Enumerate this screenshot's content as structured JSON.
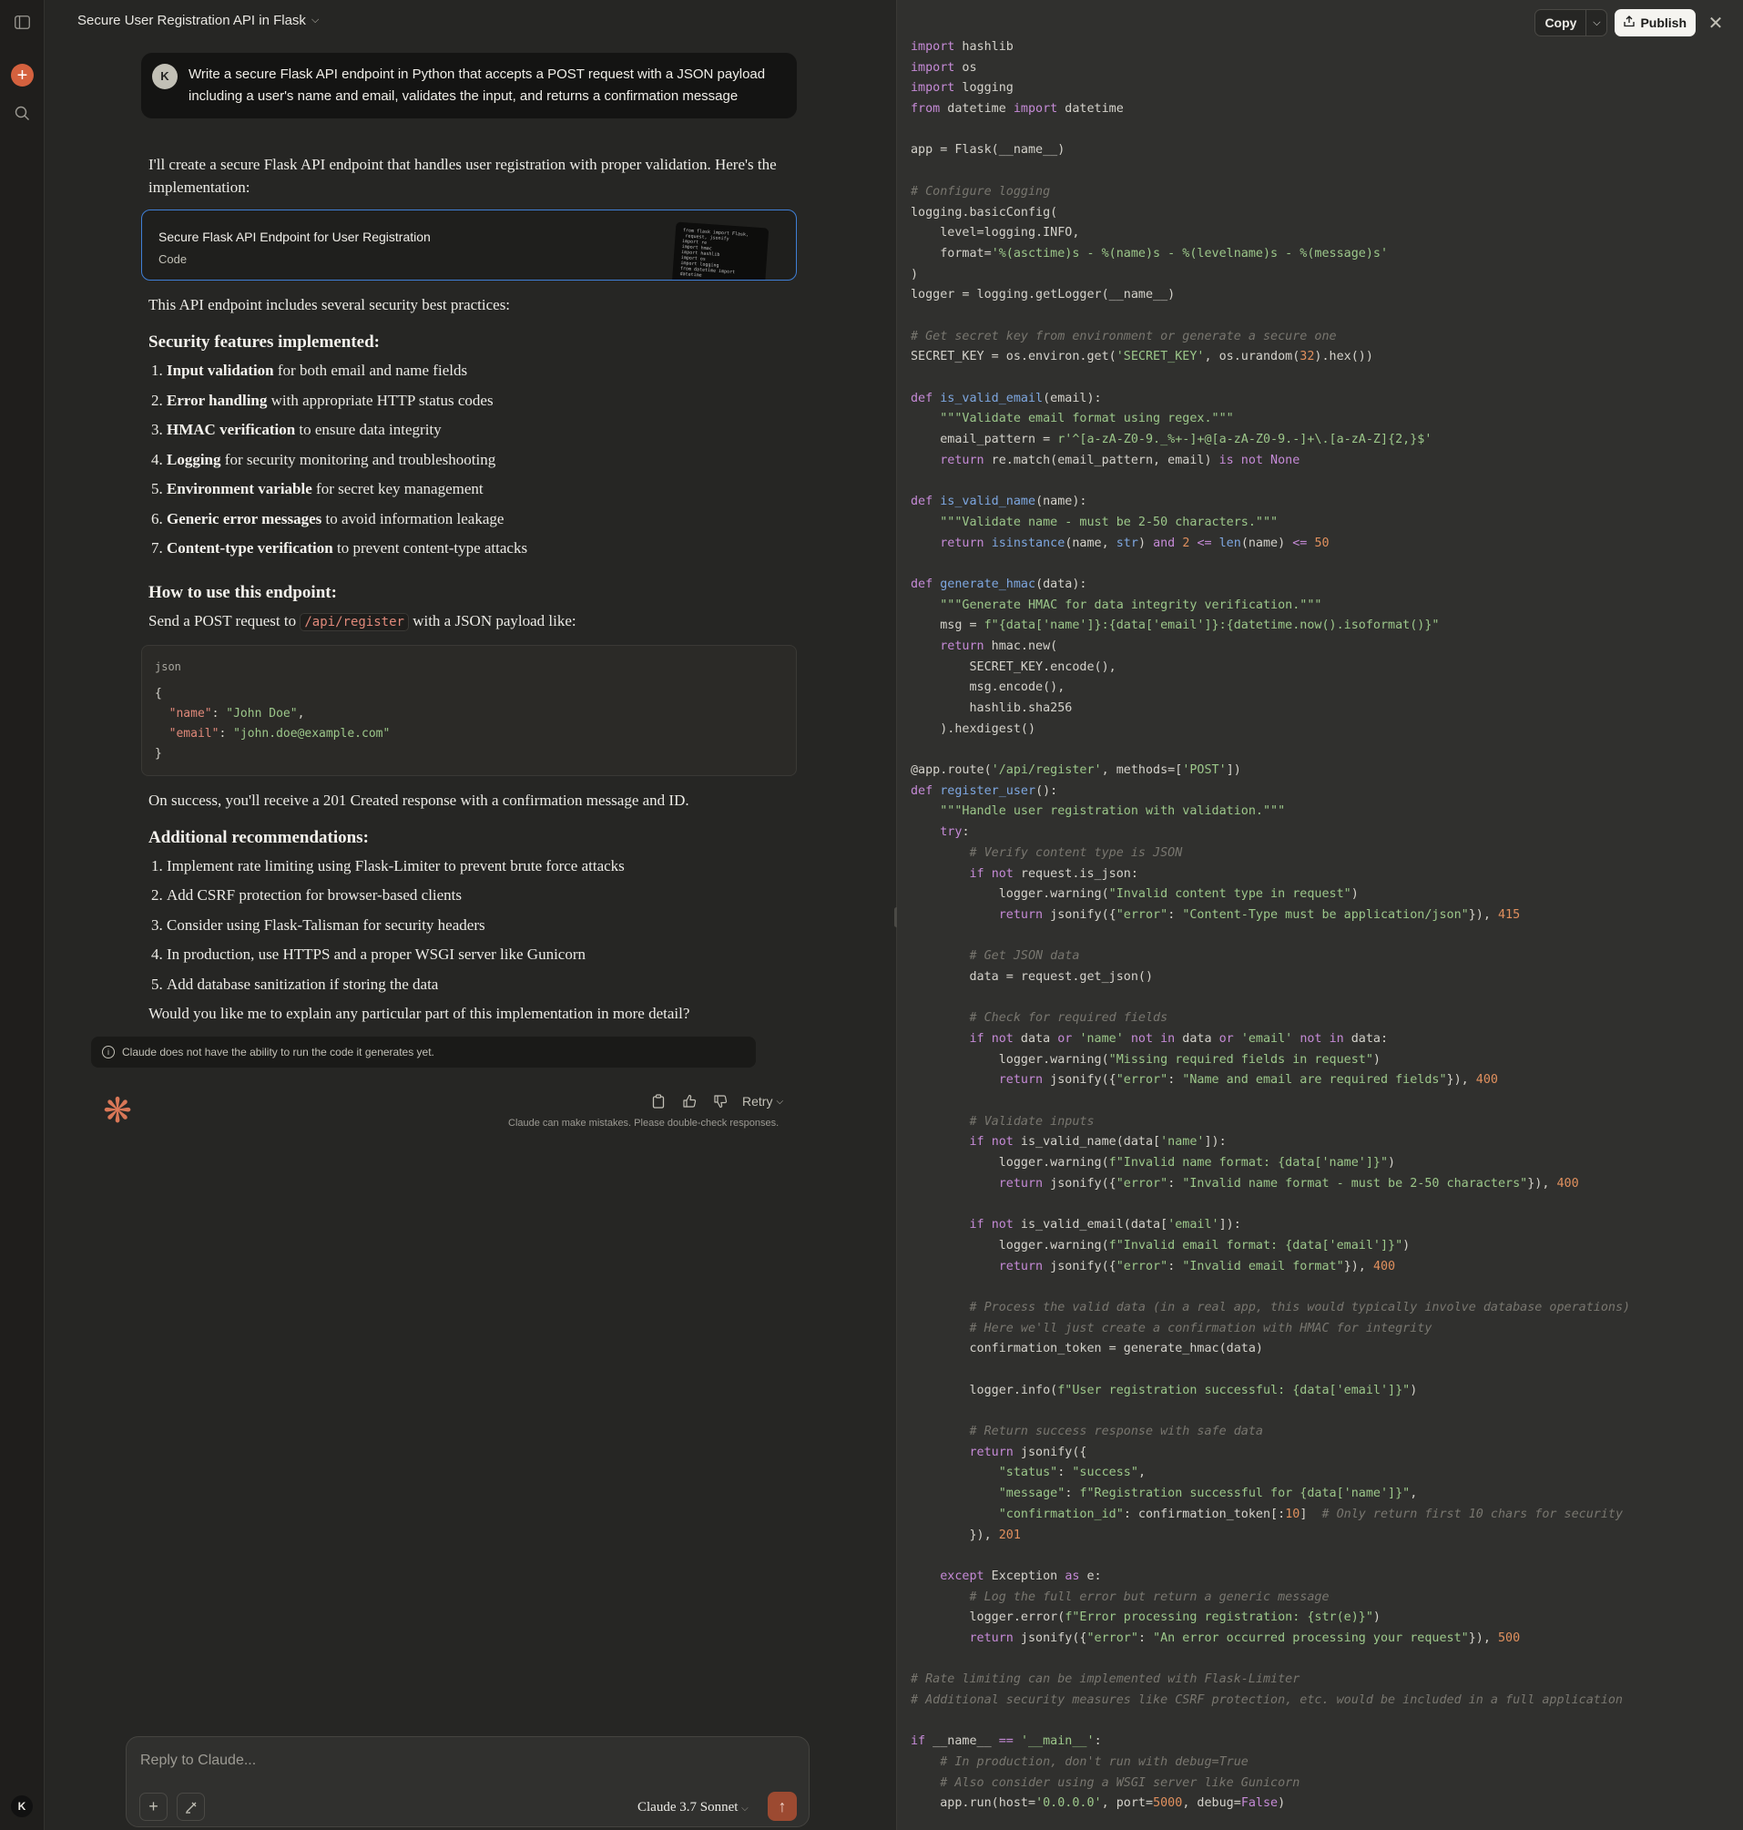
{
  "header": {
    "title": "Secure User Registration API in Flask"
  },
  "rail": {
    "new_chat_icon": "plus-icon",
    "search_icon": "search-icon",
    "sidebar_icon": "sidebar-toggle-icon",
    "user_initial": "K"
  },
  "user_message": {
    "avatar": "K",
    "text": "Write a secure Flask API endpoint in Python that accepts a POST request with a JSON payload including a user's name and email, validates the input, and returns a confirmation message"
  },
  "assistant": {
    "intro": "I'll create a secure Flask API endpoint that handles user registration with proper validation. Here's the implementation:",
    "artifact": {
      "title": "Secure Flask API Endpoint for User Registration",
      "type": "Code"
    },
    "practices_intro": "This API endpoint includes several security best practices:",
    "security_heading": "Security features implemented:",
    "security_items": [
      {
        "bold": "Input validation",
        "rest": " for both email and name fields"
      },
      {
        "bold": "Error handling",
        "rest": " with appropriate HTTP status codes"
      },
      {
        "bold": "HMAC verification",
        "rest": " to ensure data integrity"
      },
      {
        "bold": "Logging",
        "rest": " for security monitoring and troubleshooting"
      },
      {
        "bold": "Environment variable",
        "rest": " for secret key management"
      },
      {
        "bold": "Generic error messages",
        "rest": " to avoid information leakage"
      },
      {
        "bold": "Content-type verification",
        "rest": " to prevent content-type attacks"
      }
    ],
    "usage_heading": "How to use this endpoint:",
    "usage_before": "Send a POST request to ",
    "usage_code": "/api/register",
    "usage_after": " with a JSON payload like:",
    "json_lang": "json",
    "json_lines": [
      "{",
      "  \"name\": \"John Doe\",",
      "  \"email\": \"john.doe@example.com\"",
      "}"
    ],
    "success_text": "On success, you'll receive a 201 Created response with a confirmation message and ID.",
    "rec_heading": "Additional recommendations:",
    "rec_items": [
      "Implement rate limiting using Flask-Limiter to prevent brute force attacks",
      "Add CSRF protection for browser-based clients",
      "Consider using Flask-Talisman for security headers",
      "In production, use HTTPS and a proper WSGI server like Gunicorn",
      "Add database sanitization if storing the data"
    ],
    "closing": "Would you like me to explain any particular part of this implementation in more detail?",
    "notice": "Claude does not have the ability to run the code it generates yet.",
    "retry_label": "Retry",
    "disclaimer": "Claude can make mistakes. Please double-check responses."
  },
  "composer": {
    "placeholder": "Reply to Claude...",
    "model": "Claude 3.7 Sonnet"
  },
  "code_toolbar": {
    "copy_label": "Copy",
    "publish_label": "Publish"
  },
  "code_lines": [
    "import hashlib",
    "import os",
    "import logging",
    "from datetime import datetime",
    "",
    "app = Flask(__name__)",
    "",
    "# Configure logging",
    "logging.basicConfig(",
    "    level=logging.INFO,",
    "    format='%(asctime)s - %(name)s - %(levelname)s - %(message)s'",
    ")",
    "logger = logging.getLogger(__name__)",
    "",
    "# Get secret key from environment or generate a secure one",
    "SECRET_KEY = os.environ.get('SECRET_KEY', os.urandom(32).hex())",
    "",
    "def is_valid_email(email):",
    "    \"\"\"Validate email format using regex.\"\"\"",
    "    email_pattern = r'^[a-zA-Z0-9._%+-]+@[a-zA-Z0-9.-]+\\.[a-zA-Z]{2,}$'",
    "    return re.match(email_pattern, email) is not None",
    "",
    "def is_valid_name(name):",
    "    \"\"\"Validate name - must be 2-50 characters.\"\"\"",
    "    return isinstance(name, str) and 2 <= len(name) <= 50",
    "",
    "def generate_hmac(data):",
    "    \"\"\"Generate HMAC for data integrity verification.\"\"\"",
    "    msg = f\"{data['name']}:{data['email']}:{datetime.now().isoformat()}\"",
    "    return hmac.new(",
    "        SECRET_KEY.encode(),",
    "        msg.encode(),",
    "        hashlib.sha256",
    "    ).hexdigest()",
    "",
    "@app.route('/api/register', methods=['POST'])",
    "def register_user():",
    "    \"\"\"Handle user registration with validation.\"\"\"",
    "    try:",
    "        # Verify content type is JSON",
    "        if not request.is_json:",
    "            logger.warning(\"Invalid content type in request\")",
    "            return jsonify({\"error\": \"Content-Type must be application/json\"}), 415",
    "",
    "        # Get JSON data",
    "        data = request.get_json()",
    "",
    "        # Check for required fields",
    "        if not data or 'name' not in data or 'email' not in data:",
    "            logger.warning(\"Missing required fields in request\")",
    "            return jsonify({\"error\": \"Name and email are required fields\"}), 400",
    "",
    "        # Validate inputs",
    "        if not is_valid_name(data['name']):",
    "            logger.warning(f\"Invalid name format: {data['name']}\")",
    "            return jsonify({\"error\": \"Invalid name format - must be 2-50 characters\"}), 400",
    "",
    "        if not is_valid_email(data['email']):",
    "            logger.warning(f\"Invalid email format: {data['email']}\")",
    "            return jsonify({\"error\": \"Invalid email format\"}), 400",
    "",
    "        # Process the valid data (in a real app, this would typically involve database operations)",
    "        # Here we'll just create a confirmation with HMAC for integrity",
    "        confirmation_token = generate_hmac(data)",
    "",
    "        logger.info(f\"User registration successful: {data['email']}\")",
    "",
    "        # Return success response with safe data",
    "        return jsonify({",
    "            \"status\": \"success\",",
    "            \"message\": f\"Registration successful for {data['name']}\",",
    "            \"confirmation_id\": confirmation_token[:10]  # Only return first 10 chars for security",
    "        }), 201",
    "",
    "    except Exception as e:",
    "        # Log the full error but return a generic message",
    "        logger.error(f\"Error processing registration: {str(e)}\")",
    "        return jsonify({\"error\": \"An error occurred processing your request\"}), 500",
    "",
    "# Rate limiting can be implemented with Flask-Limiter",
    "# Additional security measures like CSRF protection, etc. would be included in a full application",
    "",
    "if __name__ == '__main__':",
    "    # In production, don't run with debug=True",
    "    # Also consider using a WSGI server like Gunicorn",
    "    app.run(host='0.0.0.0', port=5000, debug=False)"
  ],
  "colors": {
    "accent": "#d4613e",
    "artifact_border": "#3f7fd6",
    "spark": "#d97757"
  }
}
